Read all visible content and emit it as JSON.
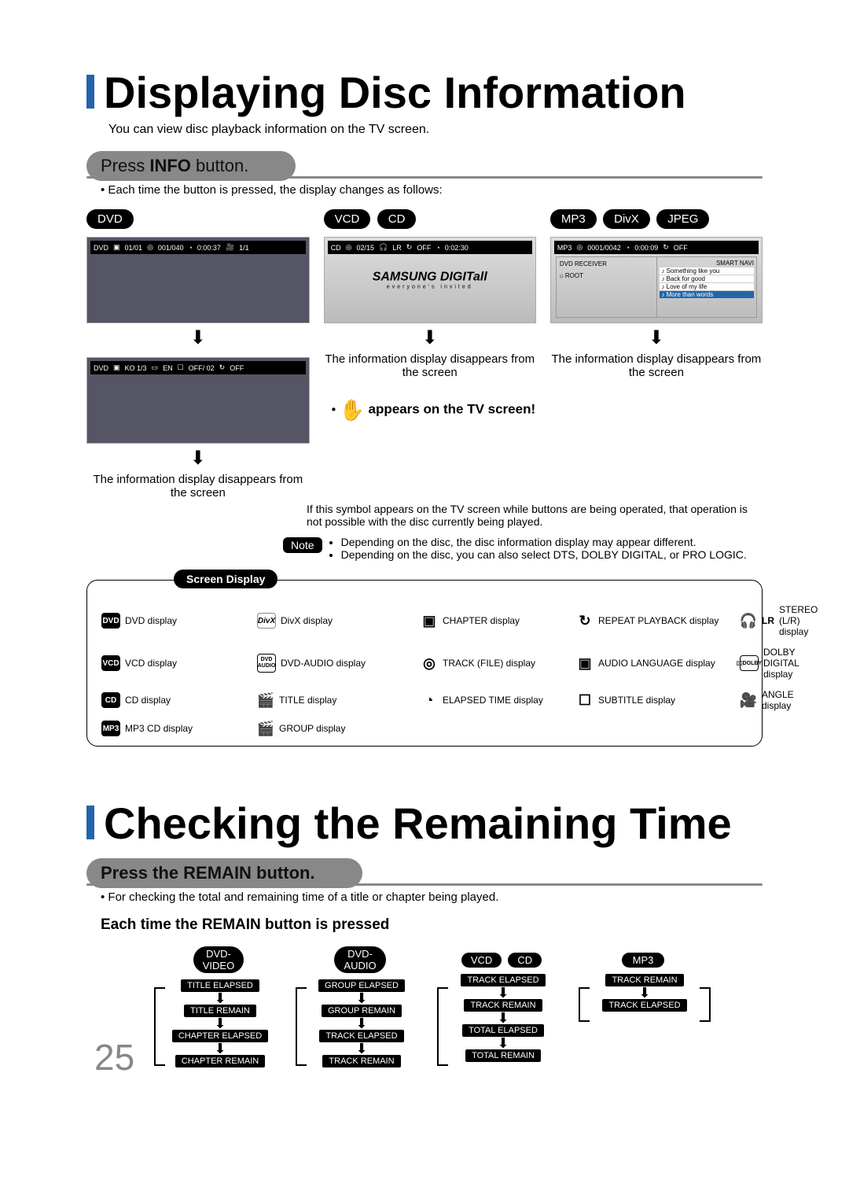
{
  "section1": {
    "title": "Displaying Disc Information",
    "subtitle": "You can view disc playback information  on the TV screen.",
    "press_label_pre": "Press ",
    "press_label_btn": "INFO",
    "press_label_post": " button.",
    "press_bullet": "• Each time the button is pressed, the display changes as follows:",
    "col_dvd": "DVD",
    "col_vcd": "VCD",
    "col_cd": "CD",
    "col_mp3": "MP3",
    "col_divx": "DivX",
    "col_jpeg": "JPEG",
    "osd_dvd1": {
      "a": "DVD",
      "b": "01/01",
      "c": "001/040",
      "d": "0:00:37",
      "e": "1/1"
    },
    "osd_dvd2": {
      "a": "DVD",
      "b": "KO 1/3",
      "c": "EN",
      "d": "OFF/ 02",
      "e": "OFF"
    },
    "osd_cd": {
      "a": "CD",
      "b": "02/15",
      "c": "LR",
      "d": "OFF",
      "e": "0:02:30"
    },
    "osd_mp3": {
      "a": "MP3",
      "b": "0001/0042",
      "c": "0:00:09",
      "d": "OFF"
    },
    "samsung_logo": "SAMSUNG DIGITall",
    "samsung_tag": "everyone's invited",
    "mp3_left_top": "DVD RECEIVER",
    "mp3_left_root": "ROOT",
    "mp3_right_top": "SMART NAVI",
    "mp3_tracks": [
      "Something like you",
      "Back for good",
      "Love of my life",
      "More than words"
    ],
    "info_disappear": "The information display disappears from the screen",
    "tv_note_label": "appears on the TV screen!",
    "tv_note_body": "If this symbol appears on the TV screen while buttons are being operated, that operation is not possible with the disc currently being played.",
    "note_label": "Note",
    "note1": "Depending on the disc, the disc information display may appear different.",
    "note2": "Depending on the disc, you can also select DTS, DOLBY DIGITAL, or PRO LOGIC.",
    "legend_title": "Screen Display",
    "legend": {
      "dvd": {
        "chip": "DVD",
        "label": "DVD display"
      },
      "divx": {
        "chip": "DivX",
        "label": "DivX display"
      },
      "chapter": "CHAPTER display",
      "repeat": "REPEAT PLAYBACK display",
      "lr": {
        "chip": "LR",
        "label": "STEREO (L/R) display"
      },
      "vcd": {
        "chip": "VCD",
        "label": "VCD display"
      },
      "dvdaudio": {
        "chip": "DVD AUDIO",
        "label": "DVD-AUDIO display"
      },
      "track": "TRACK (FILE) display",
      "audiolang": "AUDIO LANGUAGE display",
      "dolby": {
        "chip": "DOLBY DIGITAL",
        "label": "DOLBY DIGITAL display"
      },
      "cd": {
        "chip": "CD",
        "label": "CD display"
      },
      "title": "TITLE display",
      "elapsed": "ELAPSED TIME display",
      "subtitle": "SUBTITLE display",
      "angle": "ANGLE display",
      "mp3": {
        "chip": "MP3",
        "label": "MP3 CD display"
      },
      "group": "GROUP display"
    }
  },
  "section2": {
    "title": "Checking the Remaining Time",
    "press_label": "Press the REMAIN button.",
    "press_bullet": "• For checking the total and remaining time of a title or chapter being played.",
    "each_label": "Each time the REMAIN button is pressed",
    "cols": {
      "dvdvideo": {
        "hdr1": "DVD-",
        "hdr2": "VIDEO",
        "steps": [
          "TITLE ELAPSED",
          "TITLE REMAIN",
          "CHAPTER ELAPSED",
          "CHAPTER REMAIN"
        ]
      },
      "dvdaudio": {
        "hdr1": "DVD-",
        "hdr2": "AUDIO",
        "steps": [
          "GROUP ELAPSED",
          "GROUP REMAIN",
          "TRACK ELAPSED",
          "TRACK REMAIN"
        ]
      },
      "vcdcd": {
        "hdr1": "VCD",
        "hdr2": "CD",
        "steps": [
          "TRACK ELAPSED",
          "TRACK REMAIN",
          "TOTAL ELAPSED",
          "TOTAL REMAIN"
        ]
      },
      "mp3": {
        "hdr": "MP3",
        "steps": [
          "TRACK REMAIN",
          "TRACK ELAPSED"
        ]
      }
    },
    "page_number": "25"
  }
}
